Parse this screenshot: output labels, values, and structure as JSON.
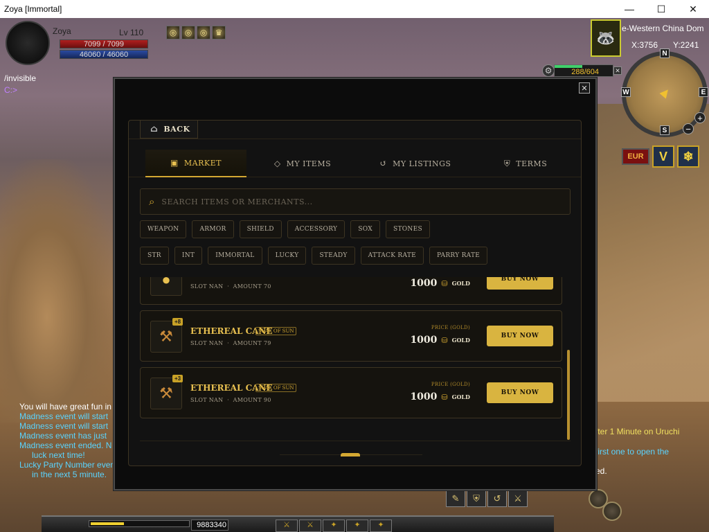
{
  "window": {
    "title": "Zoya [Immortal]",
    "min": "—",
    "max": "☐",
    "close": "✕"
  },
  "player": {
    "name": "Zoya",
    "level": "Lv 110",
    "hp": "7099 / 7099",
    "mp": "46060 / 46060"
  },
  "buffs": [
    "◎",
    "◎",
    "◎",
    "♛"
  ],
  "status": {
    "command": "/invisible",
    "prompt": "C:>"
  },
  "minimap": {
    "zone": "e-Western China Dom",
    "x": "X:3756",
    "y": "Y:2241",
    "n": "N",
    "s": "S",
    "e": "E",
    "w": "W",
    "zoom_in": "+",
    "zoom_out": "−",
    "gauge": "288/604"
  },
  "hud": {
    "badge1": "EUR",
    "badge2": "V",
    "badge3": "❄"
  },
  "chat_left": [
    {
      "text": "You will have great fun in",
      "color": "white"
    },
    {
      "text": "Madness event will start",
      "color": "cyan"
    },
    {
      "text": "Madness event will start",
      "color": "cyan"
    },
    {
      "text": "Madness event has just",
      "color": "cyan"
    },
    {
      "text": "Madness event ended. N",
      "color": "cyan"
    },
    {
      "text": "luck next time!",
      "color": "cyan"
    },
    {
      "text": "Lucky Party Number even",
      "color": "cyan"
    },
    {
      "text": "in the next 5 minute.",
      "color": "cyan"
    }
  ],
  "chat_right": [
    {
      "text": "fter 1 Minute on Uruchi",
      "color": "yellow"
    },
    {
      "text": "first one to open the",
      "color": "cyan"
    },
    {
      "text": "ed.",
      "color": "white"
    }
  ],
  "bottom": {
    "gold": "9883340"
  },
  "market": {
    "back": "BACK",
    "tabs": [
      "MARKET",
      "MY ITEMS",
      "MY LISTINGS",
      "TERMS"
    ],
    "search_placeholder": "SEARCH ITEMS OR MERCHANTS...",
    "filters_row1": [
      "WEAPON",
      "ARMOR",
      "SHIELD",
      "ACCESSORY",
      "SOX",
      "STONES"
    ],
    "filters_row2": [
      "STR",
      "INT",
      "IMMORTAL",
      "LUCKY",
      "STEADY",
      "ATTACK RATE",
      "PARRY RATE"
    ],
    "items": [
      {
        "name": "",
        "tag": "",
        "plus": "",
        "slot": "SLOT NAN",
        "amount": "AMOUNT 70",
        "price_label": "",
        "price": "1000",
        "currency": "GOLD",
        "buy": "BUY NOW"
      },
      {
        "name": "ETHEREAL CANE",
        "tag": "SEAL OF SUN",
        "plus": "+8",
        "slot": "SLOT NAN",
        "amount": "AMOUNT 79",
        "price_label": "PRICE (GOLD)",
        "price": "1000",
        "currency": "GOLD",
        "buy": "BUY NOW"
      },
      {
        "name": "ETHEREAL CANE",
        "tag": "SEAL OF SUN",
        "plus": "+3",
        "slot": "SLOT NAN",
        "amount": "AMOUNT 90",
        "price_label": "PRICE (GOLD)",
        "price": "1000",
        "currency": "GOLD",
        "buy": "BUY NOW"
      }
    ]
  },
  "colors": {
    "accent": "#d4a832",
    "hp": "#b02020",
    "mp": "#2a4aa0"
  }
}
